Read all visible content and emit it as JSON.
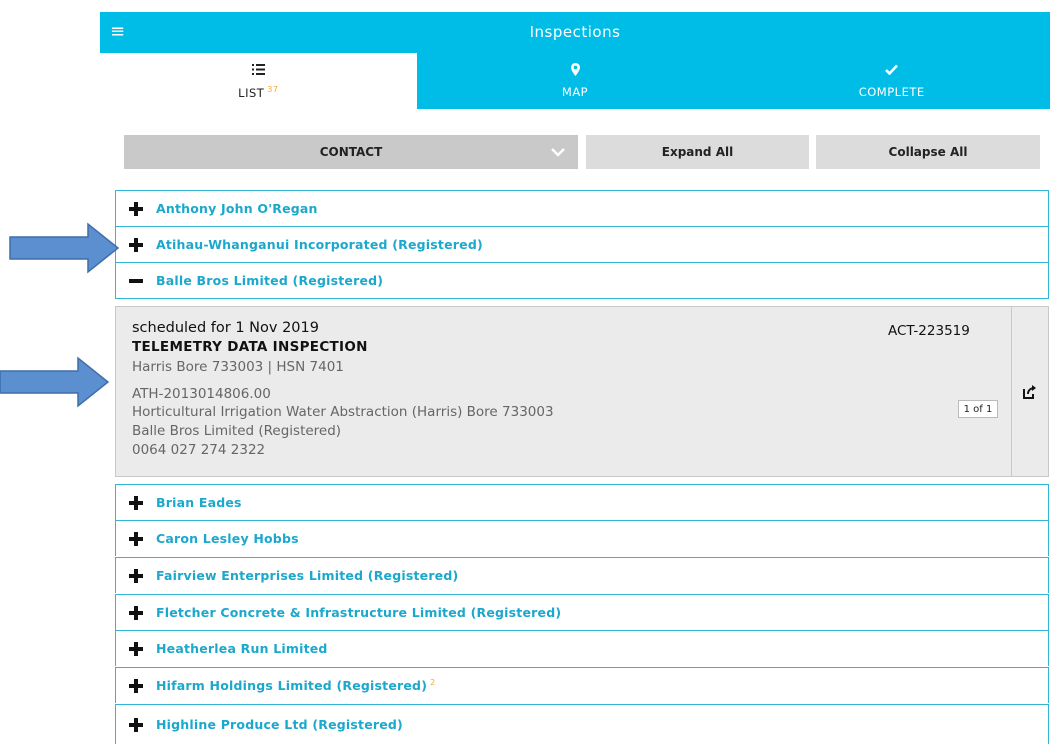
{
  "header": {
    "title": "Inspections",
    "menu_icon": "hamburger-menu-icon"
  },
  "tabs": [
    {
      "label": "LIST",
      "count": "37",
      "icon": "list-icon",
      "active": true
    },
    {
      "label": "MAP",
      "icon": "map-pin-icon"
    },
    {
      "label": "COMPLETE",
      "icon": "checkmark-icon"
    }
  ],
  "toolbar": {
    "sort_select": "CONTACT",
    "expand_label": "Expand All",
    "collapse_label": "Collapse All"
  },
  "groups_top": [
    {
      "label": "Anthony John O'Regan",
      "expanded": false
    },
    {
      "label": "Atihau-Whanganui Incorporated (Registered)",
      "expanded": false
    },
    {
      "label": "Balle Bros Limited (Registered)",
      "expanded": true
    }
  ],
  "inspection": {
    "scheduled": "scheduled for 1 Nov 2019",
    "type": "TELEMETRY DATA INSPECTION",
    "site": "Harris Bore 733003 | HSN 7401",
    "consent": "ATH-2013014806.00",
    "description": "Horticultural Irrigation Water Abstraction (Harris) Bore 733003",
    "holder": "Balle Bros Limited (Registered)",
    "phone": "0064 027 274 2322",
    "activity_id": "ACT-223519",
    "pager": "1 of 1"
  },
  "groups_bottom": [
    {
      "label": "Brian Eades"
    },
    {
      "label": "Caron Lesley Hobbs"
    },
    {
      "label": "Fairview Enterprises Limited (Registered)"
    },
    {
      "label": "Fletcher Concrete & Infrastructure Limited (Registered)"
    },
    {
      "label": "Heatherlea Run Limited"
    },
    {
      "label": "Hifarm Holdings Limited (Registered)",
      "count": "2"
    },
    {
      "label": "Highline Produce Ltd (Registered)"
    }
  ],
  "colors": {
    "accent": "#00bde8",
    "link": "#1ba8cc",
    "badge": "#f3a92f",
    "annotation_arrow": "#5b8fd0"
  }
}
